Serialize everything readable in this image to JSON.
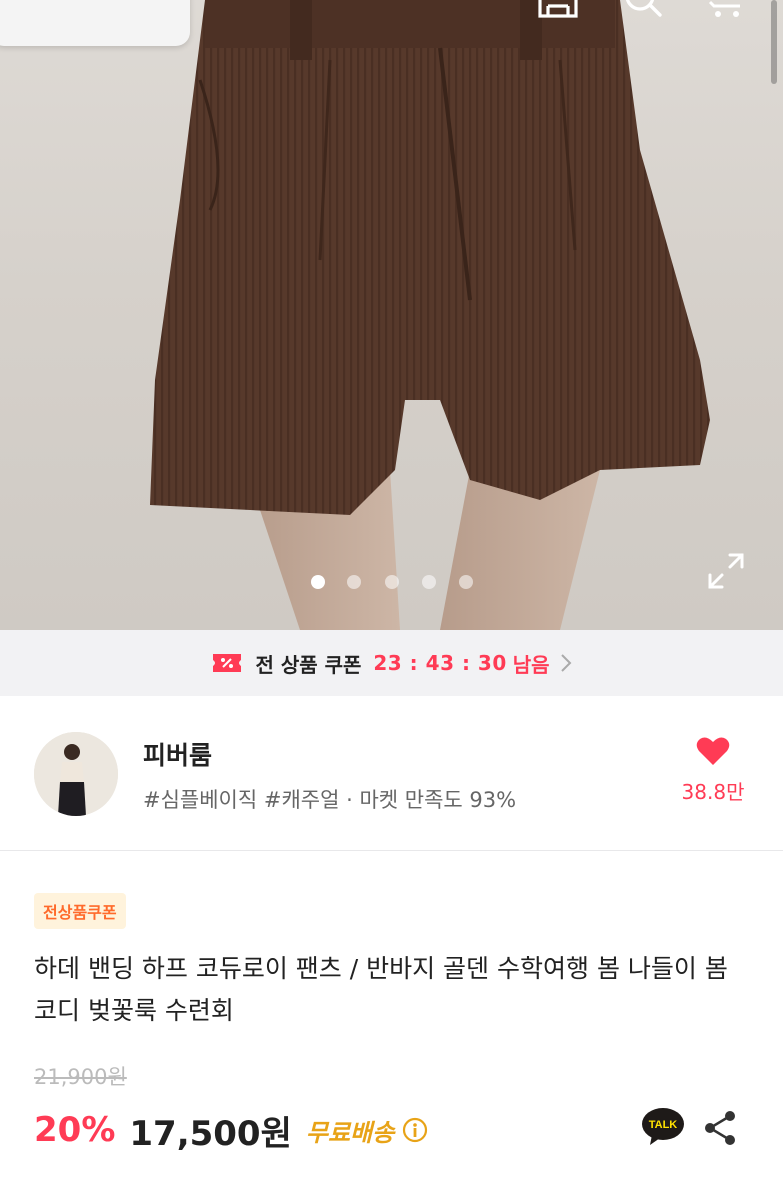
{
  "hero": {
    "slide_count": 5,
    "active_slide": 0,
    "colors": {
      "background": "#d6d1cb",
      "garment": "#5a3d2e",
      "skin": "#c9b3a3"
    }
  },
  "coupon_bar": {
    "label": "전 상품 쿠폰",
    "timer": "23 : 43 : 30",
    "remain": "남음",
    "accent": "#ff3b55"
  },
  "shop": {
    "name": "피버룸",
    "tags": "#심플베이직 #캐주얼 · 마켓 만족도 93%",
    "likes": "38.8만"
  },
  "product": {
    "badge": "전상품쿠폰",
    "title": "하데 밴딩 하프 코듀로이 팬츠 / 반바지 골덴 수학여행 봄 나들이 봄코디 벚꽃룩 수련회",
    "original_price": "21,900원",
    "discount": "20%",
    "sale_price": "17,500원",
    "shipping": "무료배송"
  },
  "icons": {
    "back": "chevron-left-icon",
    "home": "home-icon",
    "search": "search-icon",
    "cart": "cart-icon",
    "expand": "expand-icon",
    "coupon": "coupon-ticket-icon",
    "heart": "heart-icon",
    "info": "info-icon",
    "talk": "kakaotalk-icon",
    "share": "share-icon"
  }
}
